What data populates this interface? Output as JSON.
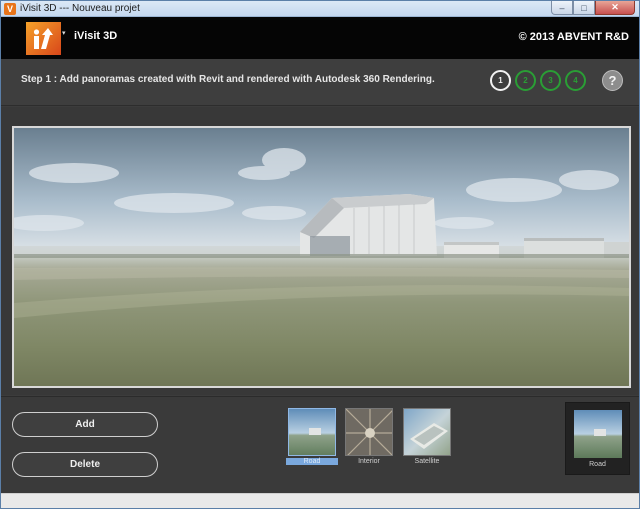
{
  "window": {
    "title": "iVisit 3D --- Nouveau projet",
    "icon_letter": "V",
    "controls": {
      "minimize": "–",
      "maximize": "□",
      "close": "✕"
    }
  },
  "header": {
    "app_name": "iVisit 3D",
    "menu_arrow": "▾",
    "copyright": "© 2013 ABVENT R&D"
  },
  "stepbar": {
    "instruction": "Step 1 : Add panoramas created with Revit and rendered with Autodesk 360 Rendering.",
    "steps": [
      "1",
      "2",
      "3",
      "4"
    ],
    "active_step": 1,
    "help": "?"
  },
  "panels": {
    "add_label": "Add",
    "delete_label": "Delete"
  },
  "thumbnails": [
    {
      "label": "Road",
      "selected": true
    },
    {
      "label": "Interior",
      "selected": false
    },
    {
      "label": "Satellite",
      "selected": false
    }
  ],
  "preview": {
    "label": "Road"
  },
  "colors": {
    "step_active": "#f2f2f2",
    "step_inactive": "#2a9e35",
    "selection": "#7aa8dd",
    "logo": "#e8741a"
  }
}
